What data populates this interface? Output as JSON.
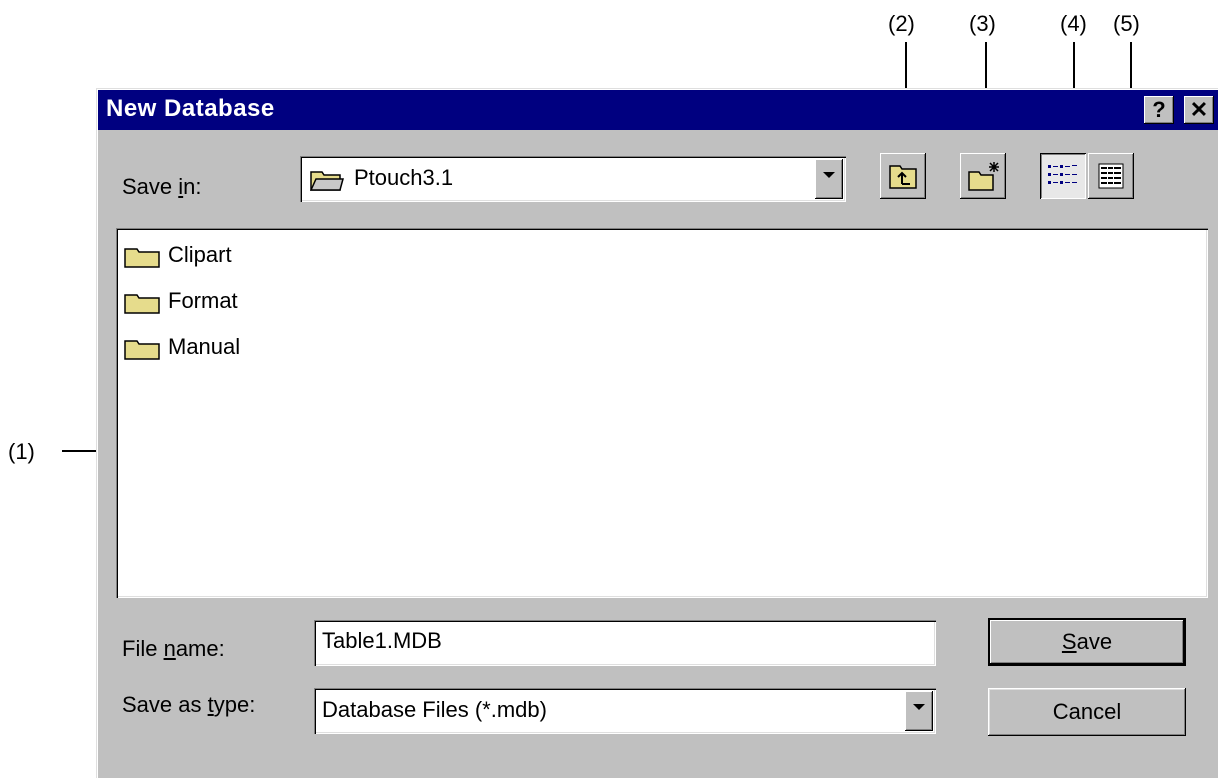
{
  "callouts": [
    "(1)",
    "(2)",
    "(3)",
    "(4)",
    "(5)"
  ],
  "dialog": {
    "title": "New Database",
    "help_glyph": "?",
    "close_glyph": "✕"
  },
  "save_in": {
    "label_pre": "Save ",
    "label_key": "i",
    "label_post": "n:",
    "value": "Ptouch3.1"
  },
  "toolbar": {
    "icons": [
      "up-one-level-icon",
      "create-new-folder-icon",
      "list-view-icon",
      "details-view-icon"
    ]
  },
  "files": [
    {
      "name": "Clipart"
    },
    {
      "name": "Format"
    },
    {
      "name": "Manual"
    }
  ],
  "file_name": {
    "label_pre": "File ",
    "label_key": "n",
    "label_post": "ame:",
    "value": "Table1.MDB"
  },
  "save_as_type": {
    "label_pre": "Save as ",
    "label_key": "t",
    "label_post": "ype:",
    "value": "Database Files (*.mdb)"
  },
  "buttons": {
    "save_key": "S",
    "save_rest": "ave",
    "cancel": "Cancel"
  },
  "colors": {
    "titlebar": "#000080",
    "face": "#c0c0c0",
    "folder": "#e6dc8c"
  }
}
